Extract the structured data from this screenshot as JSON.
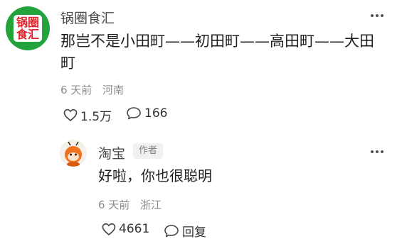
{
  "comment": {
    "avatar_text_top": "锅圈",
    "avatar_text_bottom": "食汇",
    "username": "锅圈食汇",
    "text_line1": "那岂不是小田町——初田町——高田町——大田",
    "text_line2": "町",
    "time": "6 天前",
    "location": "河南",
    "likes": "1.5万",
    "replies": "166"
  },
  "reply": {
    "username": "淘宝",
    "badge": "作者",
    "text": "好啦，你也很聪明",
    "time": "6 天前",
    "location": "浙江",
    "likes": "4661",
    "reply_label": "回复"
  },
  "colors": {
    "brand_green": "#23a33b",
    "brand_red": "#e0222a",
    "meta_gray": "#8c8c8c"
  },
  "icons": [
    "heart-icon",
    "comment-bubble-icon",
    "more-dots-icon"
  ]
}
